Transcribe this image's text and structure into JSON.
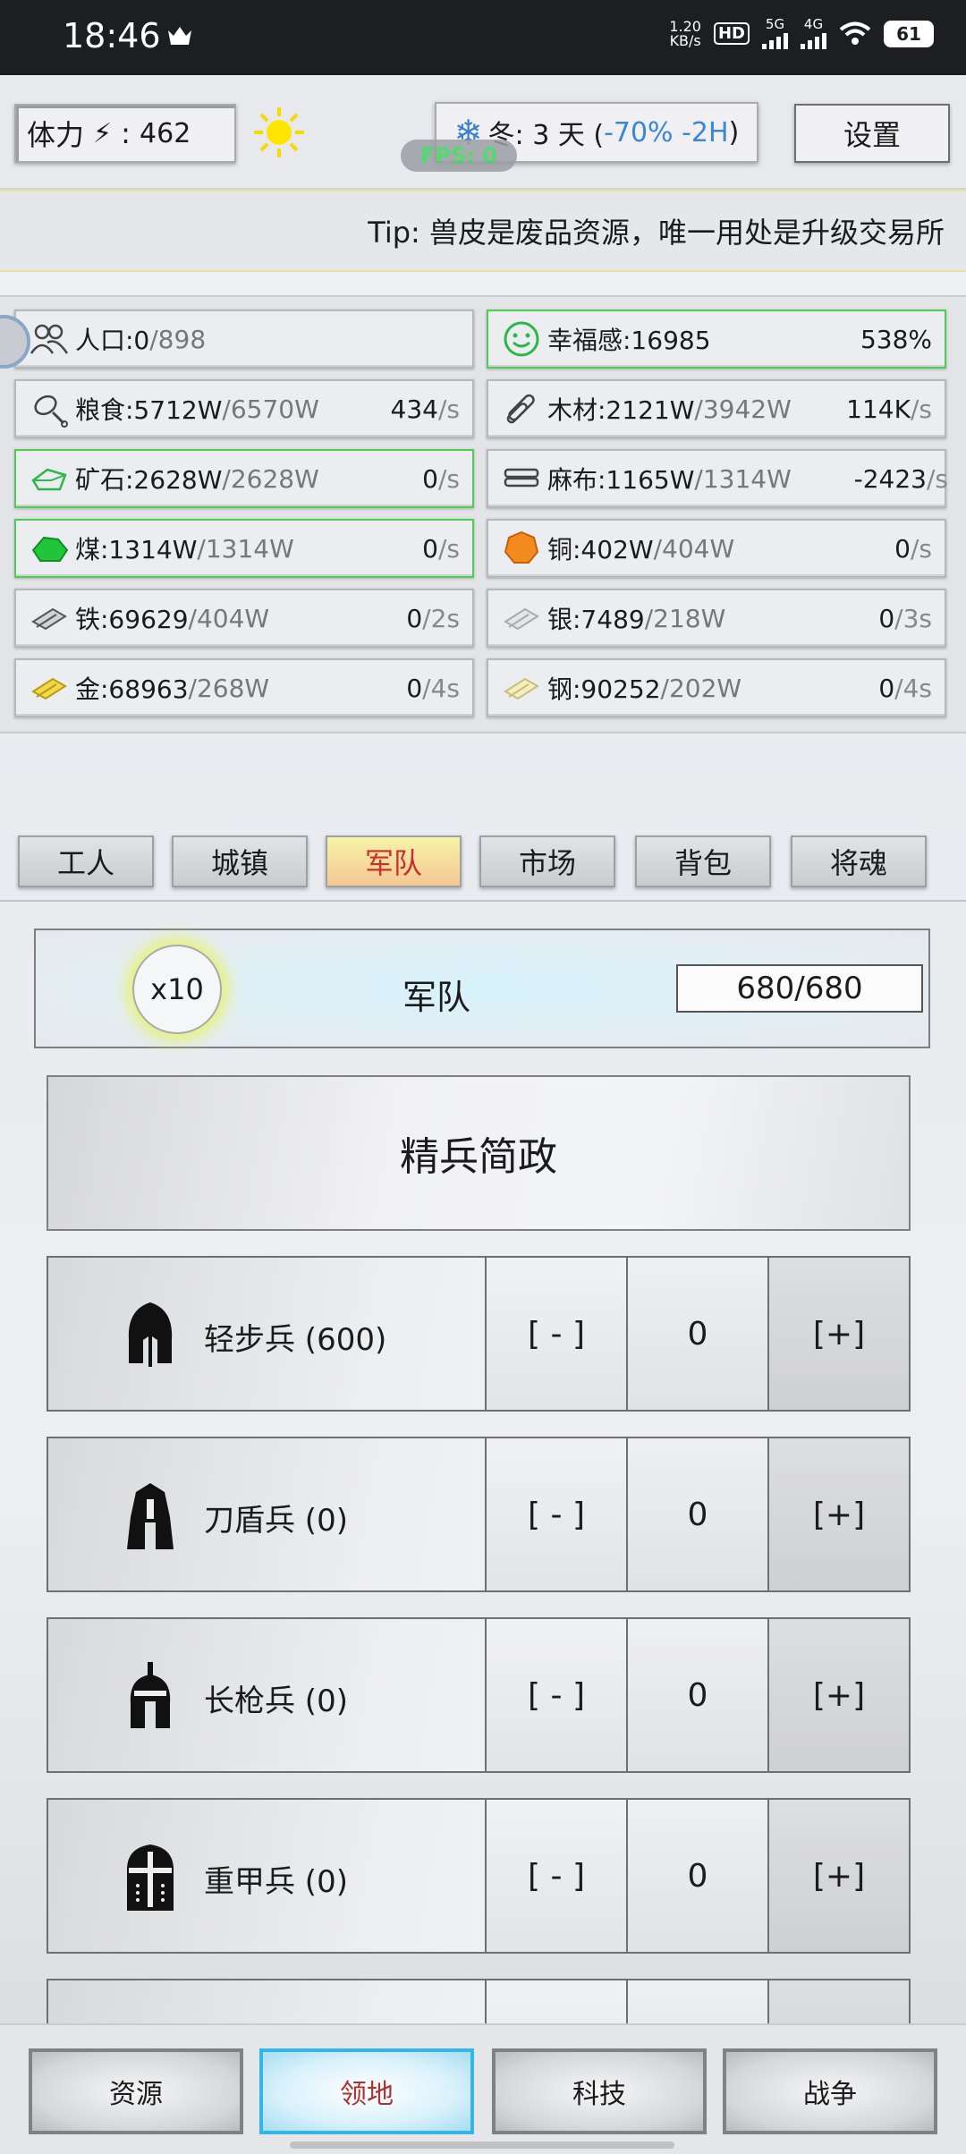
{
  "status_bar": {
    "time": "18:46",
    "net_speed_top": "1.20",
    "net_speed_bottom": "KB/s",
    "hd": "HD",
    "sig1": "5G",
    "sig2": "4G",
    "battery": "61"
  },
  "top": {
    "stamina_label": "体力",
    "stamina_value": "462",
    "season_prefix": "冬: 3 天 (",
    "season_effect": "-70% -2H",
    "season_suffix": ")",
    "settings_label": "设置",
    "fps": "FPS: 0"
  },
  "tip": "Tip:  兽皮是废品资源，唯一用处是升级交易所",
  "resources": [
    {
      "name": "人口:0",
      "cap": "/898",
      "rate": "",
      "unit": "",
      "icon": "people-icon"
    },
    {
      "name": "幸福感:16985",
      "cap": "",
      "rate": "538%",
      "unit": "",
      "icon": "smile-icon"
    },
    {
      "name": "粮食:5712W",
      "cap": "/6570W",
      "rate": "434",
      "unit": "/s",
      "icon": "food-icon"
    },
    {
      "name": "木材:2121W",
      "cap": "/3942W",
      "rate": "114K",
      "unit": "/s",
      "icon": "wood-icon"
    },
    {
      "name": "矿石:2628W",
      "cap": "/2628W",
      "rate": "0",
      "unit": "/s",
      "icon": "ore-icon"
    },
    {
      "name": "麻布:1165W",
      "cap": "/1314W",
      "rate": "-2423",
      "unit": "/s",
      "icon": "cloth-icon"
    },
    {
      "name": "煤:1314W",
      "cap": "/1314W",
      "rate": "0",
      "unit": "/s",
      "icon": "coal-icon"
    },
    {
      "name": "铜:402W",
      "cap": "/404W",
      "rate": "0",
      "unit": "/s",
      "icon": "copper-icon"
    },
    {
      "name": "铁:69629",
      "cap": "/404W",
      "rate": "0",
      "unit": "/2s",
      "icon": "iron-icon"
    },
    {
      "name": "银:7489",
      "cap": "/218W",
      "rate": "0",
      "unit": "/3s",
      "icon": "silver-icon"
    },
    {
      "name": "金:68963",
      "cap": "/268W",
      "rate": "0",
      "unit": "/4s",
      "icon": "gold-icon"
    },
    {
      "name": "钢:90252",
      "cap": "/202W",
      "rate": "0",
      "unit": "/4s",
      "icon": "steel-icon"
    }
  ],
  "tabs": [
    "工人",
    "城镇",
    "军队",
    "市场",
    "背包",
    "将魂"
  ],
  "army": {
    "multiplier": "x10",
    "title": "军队",
    "count": "680/680",
    "policy": "精兵简政",
    "units": [
      {
        "name": "轻步兵 (600)",
        "minus": "[ - ]",
        "value": "0",
        "plus": "[+]"
      },
      {
        "name": "刀盾兵 (0)",
        "minus": "[ - ]",
        "value": "0",
        "plus": "[+]"
      },
      {
        "name": "长枪兵 (0)",
        "minus": "[ - ]",
        "value": "0",
        "plus": "[+]"
      },
      {
        "name": "重甲兵 (0)",
        "minus": "[ - ]",
        "value": "0",
        "plus": "[+]"
      }
    ]
  },
  "bottom_nav": [
    "资源",
    "领地",
    "科技",
    "战争"
  ]
}
